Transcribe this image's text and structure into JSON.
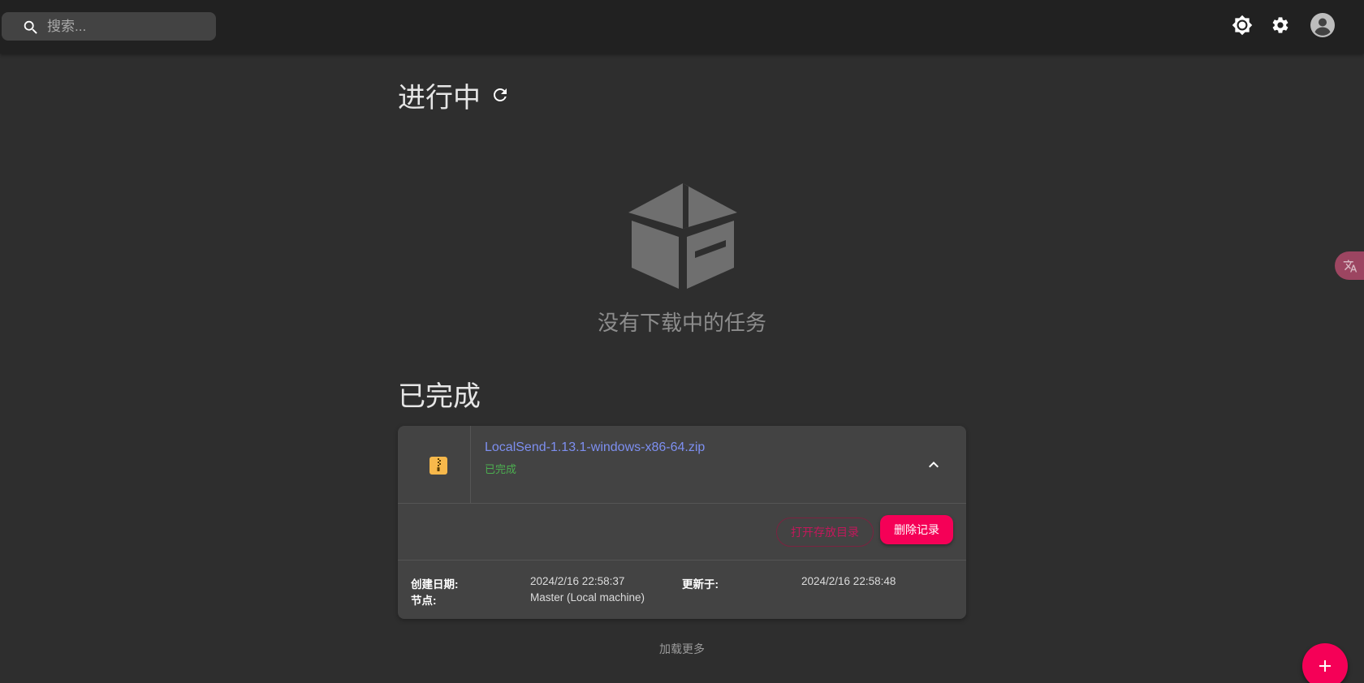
{
  "search": {
    "placeholder": "搜索..."
  },
  "header": {
    "icons": [
      "brightness-icon",
      "settings-icon",
      "account-icon"
    ]
  },
  "in_progress": {
    "title": "进行中",
    "empty_text": "没有下载中的任务"
  },
  "completed": {
    "title": "已完成",
    "task": {
      "file_name": "LocalSend-1.13.1-windows-x86-64.zip",
      "status": "已完成",
      "open_folder_label": "打开存放目录",
      "delete_label": "删除记录",
      "created_label": "创建日期:",
      "created_value": "2024/2/16 22:58:37",
      "updated_label": "更新于:",
      "updated_value": "2024/2/16 22:58:48",
      "node_label": "节点:",
      "node_value": "Master (Local machine)"
    },
    "load_more": "加载更多"
  },
  "translate_tab": {
    "label": "ᴀ"
  },
  "colors": {
    "accent": "#f50057",
    "link": "#7d8ff0",
    "success": "#4caf50",
    "zip_icon": "#f7b84b"
  }
}
